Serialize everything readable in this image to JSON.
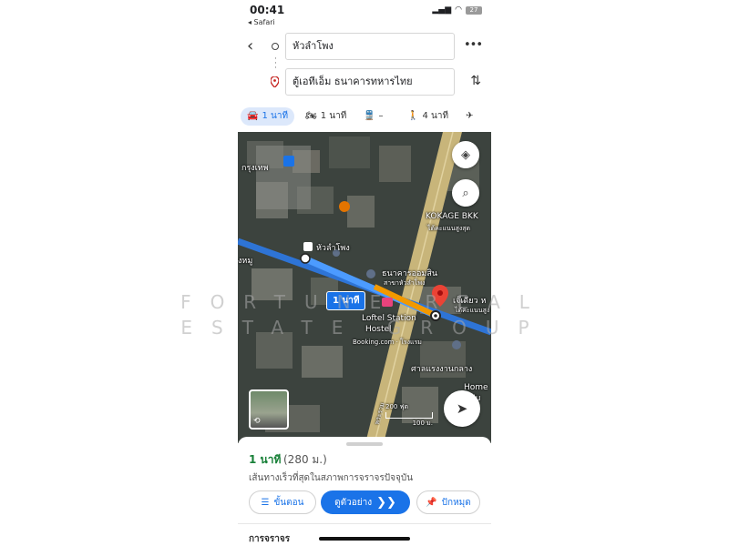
{
  "status_bar": {
    "time": "00:41",
    "back_app": "◂ Safari",
    "battery": "27"
  },
  "route": {
    "origin": "หัวลำโพง",
    "destination": "ตู้เอทีเอ็ม ธนาคารทหารไทย"
  },
  "modes": [
    {
      "name": "drive",
      "icon": "car-icon",
      "label": "1 นาที",
      "active": true
    },
    {
      "name": "motorcycle",
      "icon": "motorcycle-icon",
      "label": "1 นาที"
    },
    {
      "name": "transit",
      "icon": "train-icon",
      "label": "–"
    },
    {
      "name": "walk",
      "icon": "walk-icon",
      "label": "4 นาที"
    },
    {
      "name": "flight",
      "icon": "plane-icon",
      "label": ""
    }
  ],
  "map": {
    "labels": {
      "bangkok": "กรุงเทพ",
      "kokage": "KOKAGE BKK",
      "kokage_sub": "ได้คะแนนสูงสุด",
      "hualamphong": "หัวลำโพง",
      "nhum": "งหมู",
      "bank": "ธนาคารออมสิน",
      "bank_sub": "สาขาหัวลำโพง",
      "jay_diew": "เจ๊เดียว ห",
      "jay_sub": "ได้คะแนนสูง",
      "loftel": "Loftel Station",
      "hostel": "Hostel",
      "booking": "Booking.com · โรงแรม",
      "shrine": "ศาลแรงงานกลาง",
      "home": "Home",
      "home_sub": "Hu",
      "road": "พระราม"
    },
    "duration_badge": "1 นาที",
    "scale_ft": "200 ฟุต",
    "scale_m": "100 ม."
  },
  "watermark": {
    "line1": "FORTUNE REAL",
    "line2": "ESTATE GROUP"
  },
  "summary": {
    "duration": "1 นาที",
    "distance": "(280 ม.)",
    "description": "เส้นทางเร็วที่สุดในสภาพการจราจรปัจจุบัน"
  },
  "actions": {
    "steps": "ขั้นตอน",
    "preview": "ดูตัวอย่าง",
    "pin": "ปักหมุด"
  },
  "footer_label": "การจราจร",
  "colors": {
    "accent": "#1a73e8",
    "duration_green": "#188038",
    "route_blue": "#1a73e8",
    "route_orange": "#f29900",
    "destination_red": "#ea4335"
  }
}
